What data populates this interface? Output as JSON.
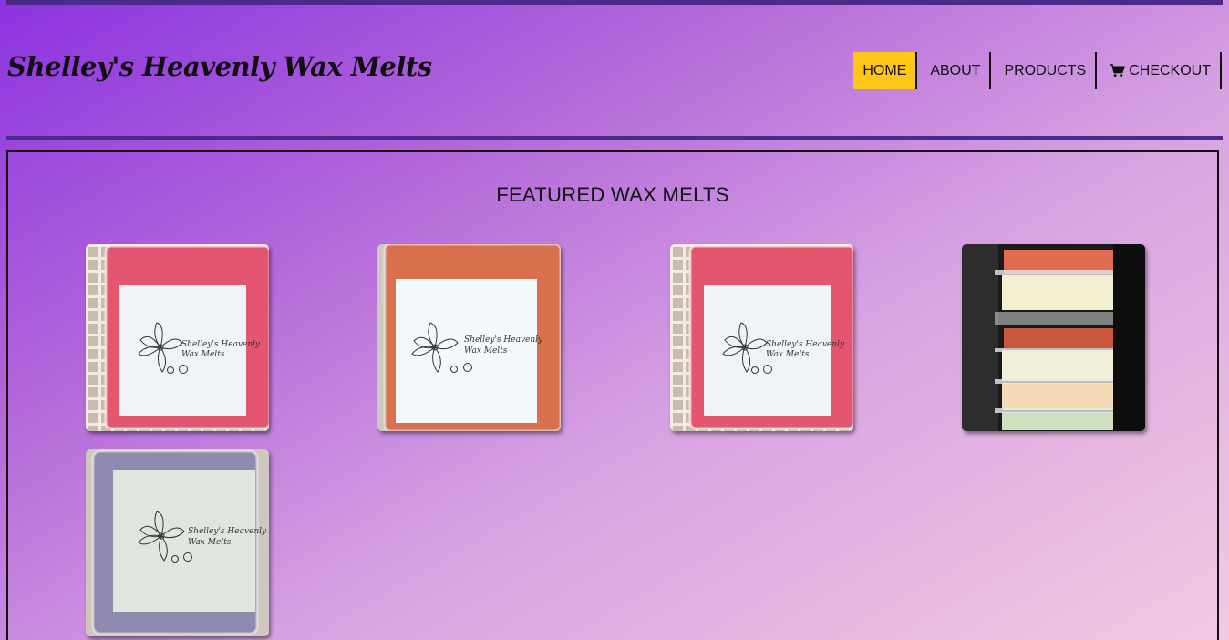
{
  "header": {
    "brand": "Shelley's Heavenly Wax Melts"
  },
  "nav": {
    "items": [
      {
        "label": "HOME",
        "active": true
      },
      {
        "label": "ABOUT",
        "active": false
      },
      {
        "label": "PRODUCTS",
        "active": false
      },
      {
        "label": "CHECKOUT",
        "active": false,
        "icon": "shopping-cart-icon"
      }
    ]
  },
  "main": {
    "title": "FEATURED WAX MELTS",
    "products": [
      {
        "name": "product-image-1",
        "wax_color": "#e4566f",
        "label_text": [
          "Shelley's Heavenly",
          "Wax Melts"
        ]
      },
      {
        "name": "product-image-2",
        "wax_color": "#d9714f",
        "label_text": [
          "Shelley's Heavenly",
          "Wax Melts"
        ]
      },
      {
        "name": "product-image-3",
        "wax_color": "#e4566f",
        "label_text": [
          "Shelley's Heavenly",
          "Wax Melts"
        ]
      },
      {
        "name": "product-image-4",
        "wax_color": "#f2f0d0",
        "label_text": []
      },
      {
        "name": "product-image-5",
        "wax_color": "#8f8bb0",
        "label_text": [
          "Shelley's Heavenly",
          "Wax Melts"
        ]
      }
    ]
  },
  "colors": {
    "nav_active": "#ffc61a",
    "bar": "#4b2a8c",
    "gradient_start": "#8b33e0",
    "gradient_end": "#f4c9e3"
  }
}
